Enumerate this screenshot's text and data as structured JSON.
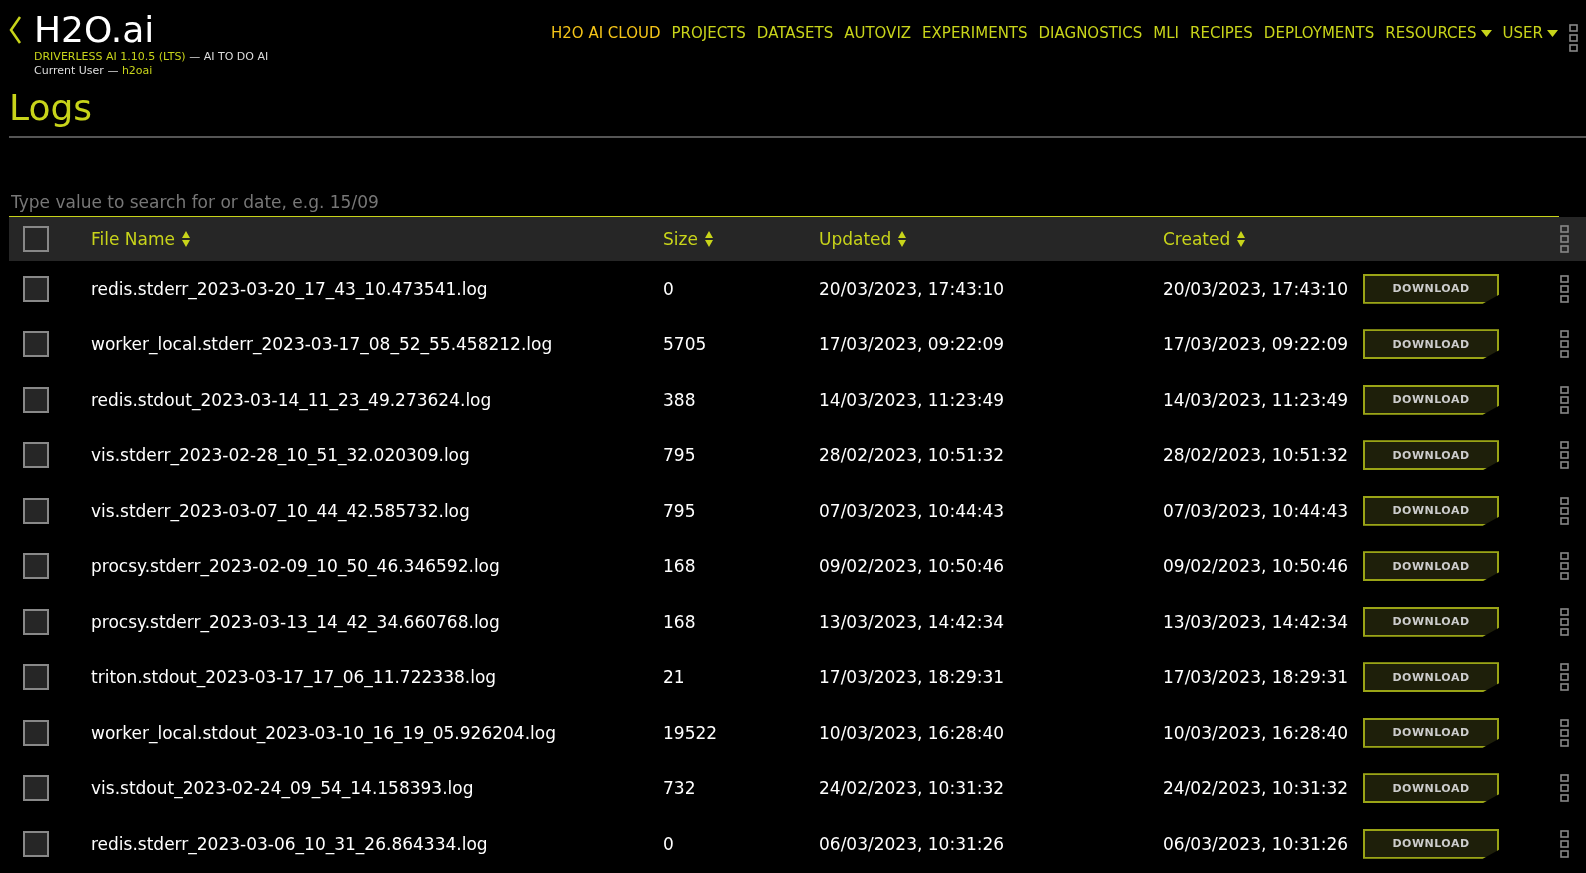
{
  "brand": {
    "logo": "H2O.ai",
    "product": "DRIVERLESS AI 1.10.5 (LTS)",
    "tagline": " — AI TO DO AI",
    "user_label": "Current User — ",
    "user": "h2oai"
  },
  "nav": [
    {
      "label": "H2O AI CLOUD",
      "selected": true,
      "dropdown": false
    },
    {
      "label": "PROJECTS",
      "selected": false,
      "dropdown": false
    },
    {
      "label": "DATASETS",
      "selected": false,
      "dropdown": false
    },
    {
      "label": "AUTOVIZ",
      "selected": false,
      "dropdown": false
    },
    {
      "label": "EXPERIMENTS",
      "selected": false,
      "dropdown": false
    },
    {
      "label": "DIAGNOSTICS",
      "selected": false,
      "dropdown": false
    },
    {
      "label": "MLI",
      "selected": false,
      "dropdown": false
    },
    {
      "label": "RECIPES",
      "selected": false,
      "dropdown": false
    },
    {
      "label": "DEPLOYMENTS",
      "selected": false,
      "dropdown": false
    },
    {
      "label": "RESOURCES",
      "selected": false,
      "dropdown": true
    },
    {
      "label": "USER",
      "selected": false,
      "dropdown": true
    }
  ],
  "page_title": "Logs",
  "search": {
    "placeholder": "Type value to search for or date, e.g. 15/09"
  },
  "table": {
    "select_all": {
      "checked": false
    },
    "columns": [
      "File Name",
      "Size",
      "Updated",
      "Created"
    ],
    "rows": [
      {
        "checked": false,
        "file": "redis.stderr_2023-03-20_17_43_10.473541.log",
        "size": "0",
        "updated": "20/03/2023, 17:43:10",
        "created": "20/03/2023, 17:43:10",
        "action": "DOWNLOAD"
      },
      {
        "checked": false,
        "file": "worker_local.stderr_2023-03-17_08_52_55.458212.log",
        "size": "5705",
        "updated": "17/03/2023, 09:22:09",
        "created": "17/03/2023, 09:22:09",
        "action": "DOWNLOAD"
      },
      {
        "checked": false,
        "file": "redis.stdout_2023-03-14_11_23_49.273624.log",
        "size": "388",
        "updated": "14/03/2023, 11:23:49",
        "created": "14/03/2023, 11:23:49",
        "action": "DOWNLOAD"
      },
      {
        "checked": false,
        "file": "vis.stderr_2023-02-28_10_51_32.020309.log",
        "size": "795",
        "updated": "28/02/2023, 10:51:32",
        "created": "28/02/2023, 10:51:32",
        "action": "DOWNLOAD"
      },
      {
        "checked": false,
        "file": "vis.stderr_2023-03-07_10_44_42.585732.log",
        "size": "795",
        "updated": "07/03/2023, 10:44:43",
        "created": "07/03/2023, 10:44:43",
        "action": "DOWNLOAD"
      },
      {
        "checked": false,
        "file": "procsy.stderr_2023-02-09_10_50_46.346592.log",
        "size": "168",
        "updated": "09/02/2023, 10:50:46",
        "created": "09/02/2023, 10:50:46",
        "action": "DOWNLOAD"
      },
      {
        "checked": false,
        "file": "procsy.stderr_2023-03-13_14_42_34.660768.log",
        "size": "168",
        "updated": "13/03/2023, 14:42:34",
        "created": "13/03/2023, 14:42:34",
        "action": "DOWNLOAD"
      },
      {
        "checked": false,
        "file": "triton.stdout_2023-03-17_17_06_11.722338.log",
        "size": "21",
        "updated": "17/03/2023, 18:29:31",
        "created": "17/03/2023, 18:29:31",
        "action": "DOWNLOAD"
      },
      {
        "checked": false,
        "file": "worker_local.stdout_2023-03-10_16_19_05.926204.log",
        "size": "19522",
        "updated": "10/03/2023, 16:28:40",
        "created": "10/03/2023, 16:28:40",
        "action": "DOWNLOAD"
      },
      {
        "checked": false,
        "file": "vis.stdout_2023-02-24_09_54_14.158393.log",
        "size": "732",
        "updated": "24/02/2023, 10:31:32",
        "created": "24/02/2023, 10:31:32",
        "action": "DOWNLOAD"
      },
      {
        "checked": false,
        "file": "redis.stderr_2023-03-06_10_31_26.864334.log",
        "size": "0",
        "updated": "06/03/2023, 10:31:26",
        "created": "06/03/2023, 10:31:26",
        "action": "DOWNLOAD"
      }
    ]
  }
}
